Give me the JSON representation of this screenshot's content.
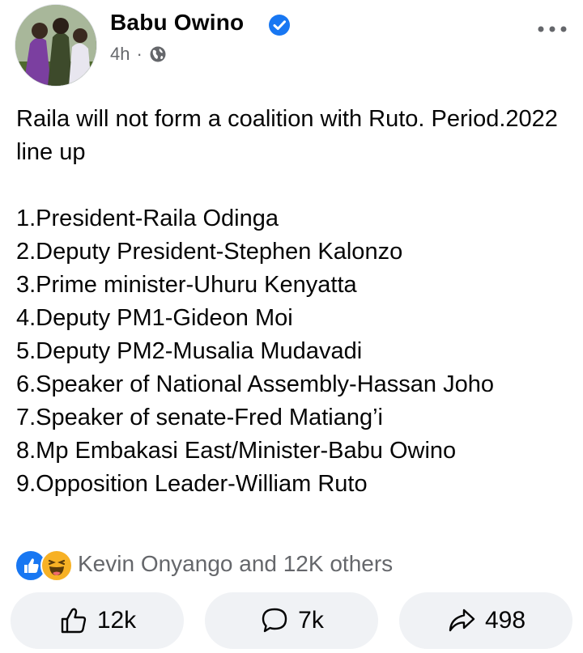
{
  "post": {
    "author": "Babu Owino",
    "time": "4h",
    "separator": "·",
    "text": "Raila will not form a coalition with Ruto. Period.2022 line up\n\n1.President-Raila Odinga\n2.Deputy President-Stephen Kalonzo\n3.Prime minister-Uhuru Kenyatta\n4.Deputy PM1-Gideon Moi\n5.Deputy PM2-Musalia Mudavadi\n6.Speaker of National Assembly-Hassan Joho\n7.Speaker of senate-Fred Matiang’i\n8.Mp Embakasi East/Minister-Babu Owino\n9.Opposition Leader-William Ruto"
  },
  "reactions": {
    "summary": "Kevin Onyango and 12K others",
    "icons": [
      "like-reaction-icon",
      "haha-reaction-icon"
    ]
  },
  "actions": {
    "like_count": "12k",
    "comment_count": "7k",
    "share_count": "498"
  },
  "icons": {
    "verified": "verified-badge-icon",
    "audience": "globe-icon",
    "more": "more-options-icon"
  },
  "colors": {
    "accent": "#1877f2",
    "secondary_text": "#65676b",
    "button_bg": "#f0f2f5",
    "haha": "#f7b125"
  }
}
